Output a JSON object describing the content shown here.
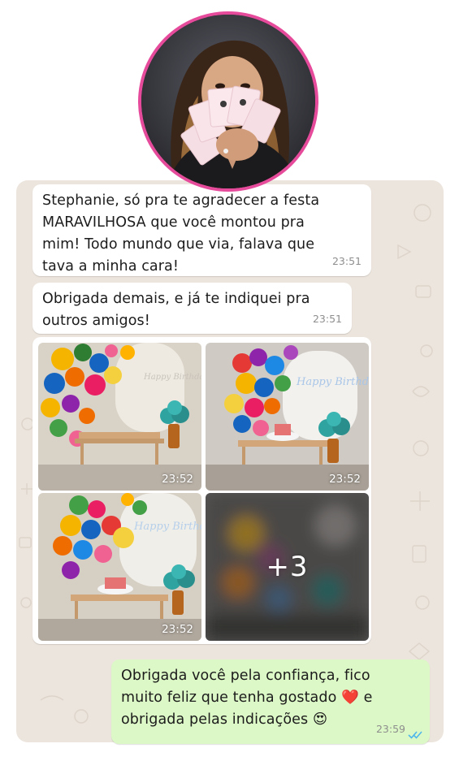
{
  "messages": [
    {
      "text": "Stephanie, só pra te agradecer a festa\nMARAVILHOSA que você montou pra\nmim! Todo mundo que via, falava que\ntava a minha cara!",
      "time": "23:51"
    },
    {
      "text": "Obrigada demais, e já te indiquei pra\noutros amigos!",
      "time": "23:51"
    },
    {
      "text": "Obrigada você pela confiança, fico\nmuito feliz que tenha gostado ❤️ e\nobrigada pelas indicações 😍",
      "time": "23:59"
    }
  ],
  "media": {
    "photo_times": [
      "23:52",
      "23:52",
      "23:52"
    ],
    "more_count": "+3",
    "photo_signs": [
      "Happy Birthday",
      "Happy Birthday",
      "Happy Birthday"
    ]
  },
  "colors": {
    "chat_background": "#ece5dd",
    "incoming_bubble": "#ffffff",
    "outgoing_bubble": "#dcf8c6",
    "read_ticks": "#4fb6ec",
    "avatar_ring": "#e64a9b"
  },
  "icons": {
    "read_receipt": "double-check-icon"
  }
}
